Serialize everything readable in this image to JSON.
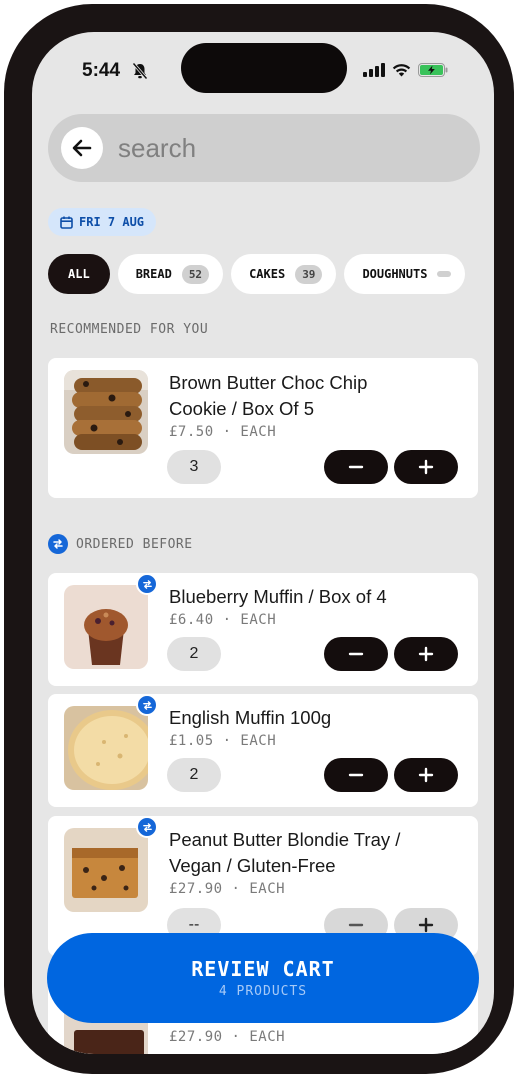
{
  "status_bar": {
    "time": "5:44"
  },
  "search": {
    "placeholder": "search",
    "value": ""
  },
  "date_chip": {
    "label": "FRI 7 AUG"
  },
  "filters": [
    {
      "label": "ALL",
      "active": true
    },
    {
      "label": "BREAD",
      "count": "52"
    },
    {
      "label": "CAKES",
      "count": "39"
    },
    {
      "label": "DOUGHNUTS",
      "count": ""
    }
  ],
  "sections": {
    "recommended": "RECOMMENDED FOR YOU",
    "ordered_before": "ORDERED BEFORE"
  },
  "recommended_items": [
    {
      "name_line1": "Brown Butter Choc Chip",
      "name_line2": "Cookie / Box Of 5",
      "price": "£7.50 · EACH",
      "qty": "3"
    }
  ],
  "ordered_items": [
    {
      "name": "Blueberry Muffin / Box of 4",
      "price": "£6.40 · EACH",
      "qty": "2"
    },
    {
      "name": "English Muffin 100g",
      "price": "£1.05 · EACH",
      "qty": "2"
    },
    {
      "name_line1": "Peanut Butter Blondie Tray /",
      "name_line2": "Vegan / Gluten-Free",
      "price": "£27.90 · EACH",
      "qty": "--"
    },
    {
      "price": "£27.90 · EACH"
    }
  ],
  "review_cart": {
    "label": "REVIEW CART",
    "sub_label": "4 PRODUCTS"
  },
  "icons": {
    "back": "arrow-left-icon",
    "calendar": "calendar-icon",
    "reorder": "swap-icon",
    "minus": "minus-icon",
    "plus": "plus-icon"
  },
  "colors": {
    "accent": "#0066e0",
    "dark": "#140d0d",
    "badge_blue": "#1567d8"
  }
}
